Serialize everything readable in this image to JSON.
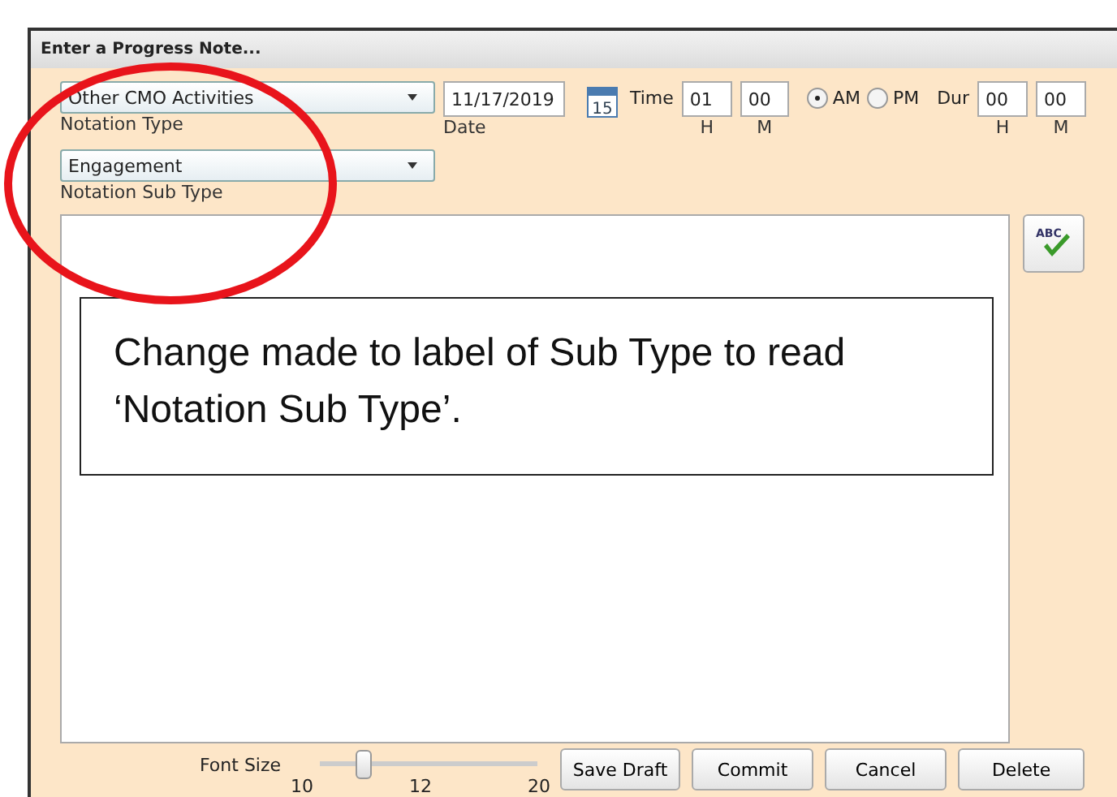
{
  "window": {
    "title": "Enter a Progress Note..."
  },
  "notation_type": {
    "value": "Other CMO Activities",
    "label": "Notation Type"
  },
  "date": {
    "value": "11/17/2019",
    "label": "Date",
    "calendar_day": "15"
  },
  "time": {
    "label": "Time",
    "hour": "01",
    "minute": "00",
    "hour_label": "H",
    "minute_label": "M"
  },
  "period": [
    {
      "label": "AM",
      "selected": true
    },
    {
      "label": "PM",
      "selected": false
    }
  ],
  "duration": {
    "label": "Dur",
    "hour": "00",
    "minute": "00",
    "hour_label": "H",
    "minute_label": "M"
  },
  "notation_sub_type": {
    "value": "Engagement",
    "label": "Notation Sub Type"
  },
  "spellcheck": {
    "label": "ABC"
  },
  "font_size": {
    "label": "Font Size",
    "level": 0.2,
    "ticks": [
      "10",
      "12",
      "20"
    ]
  },
  "buttons": [
    "Save Draft",
    "Commit",
    "Cancel",
    "Delete"
  ],
  "annotation": {
    "text": "Change made to label of Sub Type to read ‘Notation Sub Type’."
  }
}
